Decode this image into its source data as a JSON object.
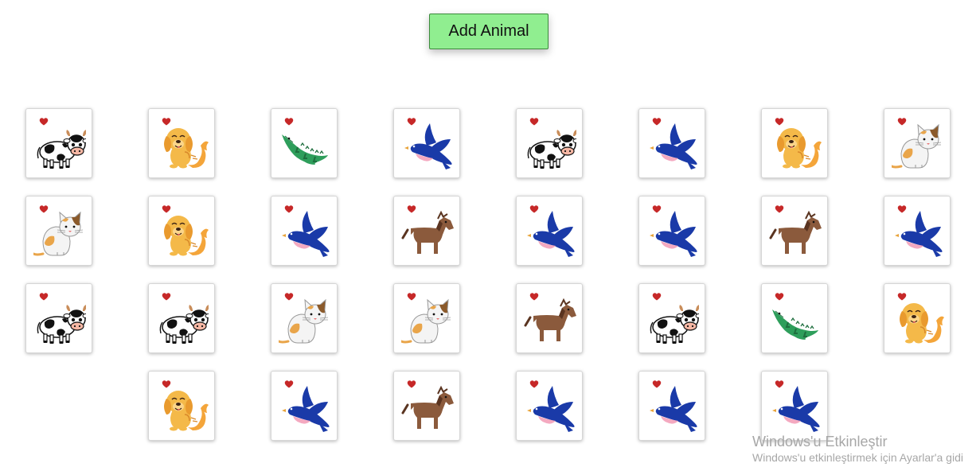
{
  "toolbar": {
    "add_label": "Add Animal"
  },
  "colors": {
    "button_bg": "#90ee90",
    "heart": "#c62828"
  },
  "animals": [
    [
      "cow",
      "dog",
      "crocodile",
      "bird",
      "cow",
      "bird",
      "dog",
      "cat"
    ],
    [
      "cat",
      "dog",
      "bird",
      "horse",
      "bird",
      "bird",
      "horse",
      "bird"
    ],
    [
      "cow",
      "cow",
      "cat",
      "cat",
      "horse",
      "cow",
      "crocodile",
      "dog"
    ],
    [
      null,
      "dog",
      "bird",
      "horse",
      "bird",
      "bird",
      "bird",
      null
    ]
  ],
  "watermark": {
    "title": "Windows'u Etkinleştir",
    "subtitle": "Windows'u etkinleştirmek için Ayarlar'a gidi"
  }
}
